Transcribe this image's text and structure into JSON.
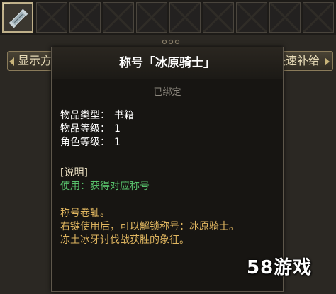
{
  "slots": {
    "count": 10,
    "selected_index": 0,
    "items": [
      {
        "icon": "scroll-icon"
      },
      {
        "icon": "empty-slot"
      },
      {
        "icon": "empty-slot"
      },
      {
        "icon": "empty-slot"
      },
      {
        "icon": "empty-slot"
      },
      {
        "icon": "empty-slot"
      },
      {
        "icon": "empty-slot"
      },
      {
        "icon": "empty-slot"
      },
      {
        "icon": "empty-slot"
      },
      {
        "icon": "empty-slot"
      }
    ]
  },
  "tabs": {
    "left_label": "显示方",
    "right_label": "快速补给"
  },
  "tooltip": {
    "title": "称号「冰原骑士」",
    "bound_status": "已绑定",
    "item_type_label": "物品类型：",
    "item_type_value": "书籍",
    "item_level_label": "物品等级：",
    "item_level_value": "1",
    "role_level_label": "角色等级：",
    "role_level_value": "1",
    "section_title": "[说明]",
    "use_text": "使用：获得对应称号",
    "desc_line1": "称号卷轴。",
    "desc_line2": "右键使用后，可以解锁称号：冰原骑士。",
    "desc_line3": "冻土冰牙讨伐战获胜的象征。"
  },
  "colors": {
    "use_green": "#57c06b",
    "desc_gold": "#e0b660",
    "bound_gray": "#8f8a80"
  },
  "watermark": "58游戏"
}
